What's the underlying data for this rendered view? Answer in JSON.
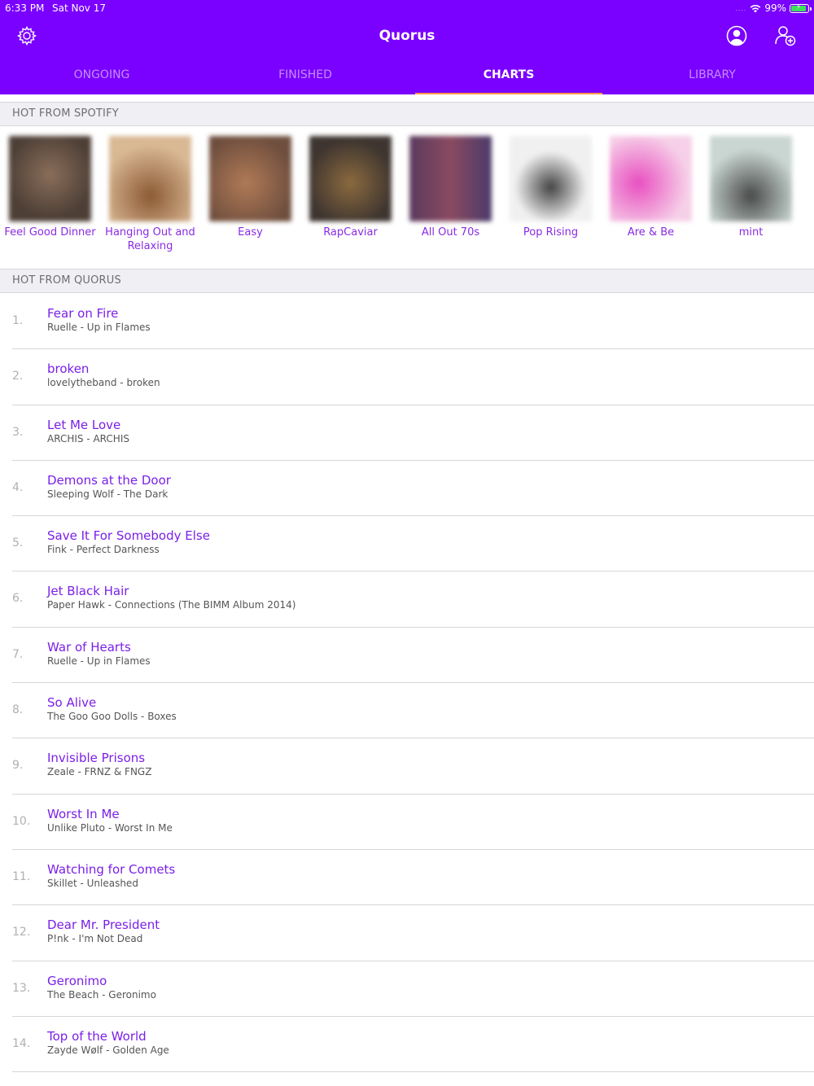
{
  "status_bar": {
    "time": "6:33 PM",
    "date": "Sat Nov 17",
    "signal_dots": "....",
    "battery": "99%"
  },
  "header": {
    "title": "Quorus",
    "background_color": "#7a00ff",
    "icons": [
      "gear-icon",
      "profile-icon",
      "add-user-icon"
    ]
  },
  "tabs": [
    {
      "label": "ONGOING",
      "active": false
    },
    {
      "label": "FINISHED",
      "active": false
    },
    {
      "label": "CHARTS",
      "active": true
    },
    {
      "label": "LIBRARY",
      "active": false
    }
  ],
  "spotify_section": {
    "title": "HOT FROM SPOTIFY",
    "playlists": [
      {
        "label": "Feel Good Dinner",
        "color": "#6b5a4e"
      },
      {
        "label": "Hanging Out and Relaxing",
        "color": "#b98a5e"
      },
      {
        "label": "Easy",
        "color": "#a77b5d"
      },
      {
        "label": "RapCaviar",
        "color": "#5b4a3c"
      },
      {
        "label": "All Out 70s",
        "color": "#6a4a64"
      },
      {
        "label": "Pop Rising",
        "color": "#8f8f8f"
      },
      {
        "label": "Are & Be",
        "color": "#e07fc6"
      },
      {
        "label": "mint",
        "color": "#7b8a86"
      }
    ]
  },
  "quorus_section": {
    "title": "HOT FROM QUORUS",
    "tracks": [
      {
        "num": "1.",
        "title": "Fear on Fire",
        "subtitle": "Ruelle - Up in Flames"
      },
      {
        "num": "2.",
        "title": "broken",
        "subtitle": "lovelytheband - broken"
      },
      {
        "num": "3.",
        "title": "Let Me Love",
        "subtitle": "ARCHIS - ARCHIS"
      },
      {
        "num": "4.",
        "title": "Demons at the Door",
        "subtitle": "Sleeping Wolf - The Dark"
      },
      {
        "num": "5.",
        "title": "Save It For Somebody Else",
        "subtitle": "Fink - Perfect Darkness"
      },
      {
        "num": "6.",
        "title": "Jet Black Hair",
        "subtitle": "Paper Hawk - Connections (The BIMM Album 2014)"
      },
      {
        "num": "7.",
        "title": "War of Hearts",
        "subtitle": "Ruelle - Up in Flames"
      },
      {
        "num": "8.",
        "title": "So Alive",
        "subtitle": "The Goo Goo Dolls - Boxes"
      },
      {
        "num": "9.",
        "title": "Invisible Prisons",
        "subtitle": "Zeale - FRNZ & FNGZ"
      },
      {
        "num": "10.",
        "title": "Worst In Me",
        "subtitle": "Unlike Pluto - Worst In Me"
      },
      {
        "num": "11.",
        "title": "Watching for Comets",
        "subtitle": "Skillet - Unleashed"
      },
      {
        "num": "12.",
        "title": "Dear Mr. President",
        "subtitle": "P!nk - I'm Not Dead"
      },
      {
        "num": "13.",
        "title": "Geronimo",
        "subtitle": "The Beach - Geronimo"
      },
      {
        "num": "14.",
        "title": "Top of the World",
        "subtitle": "Zayde Wølf - Golden Age"
      }
    ]
  },
  "colors": {
    "accent": "#7a00ff",
    "link": "#7a1fe8",
    "tab_indicator": "#ff9a4a",
    "section_bg": "#efeff4"
  }
}
